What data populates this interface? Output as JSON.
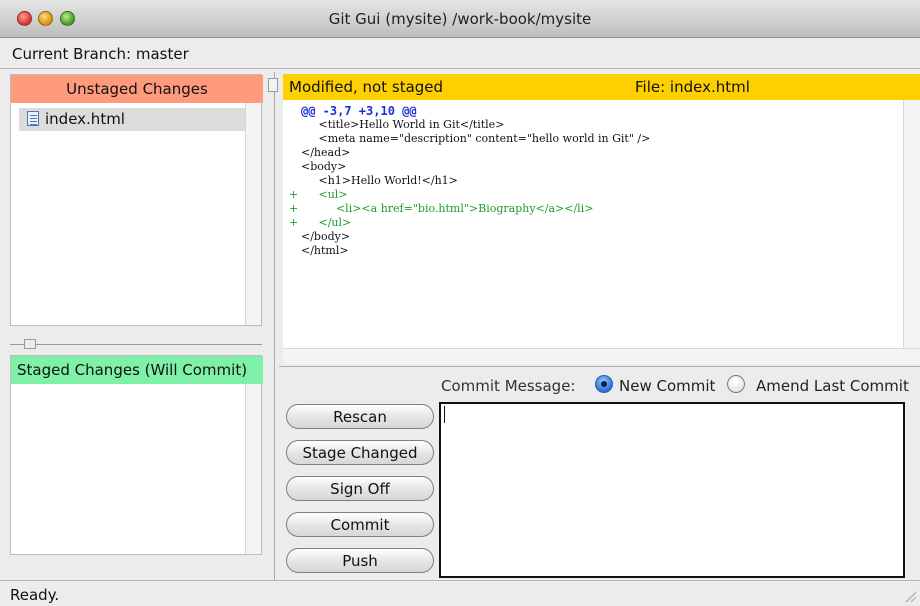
{
  "window": {
    "title": "Git Gui (mysite) /work-book/mysite",
    "colors": {
      "close": "#d63b2c",
      "minimize": "#d9930c",
      "zoom": "#4a9d26"
    }
  },
  "branch": {
    "label": "Current Branch: master"
  },
  "unstaged": {
    "header": "Unstaged Changes",
    "header_color": "#ff9a7c",
    "files": [
      {
        "name": "index.html",
        "icon": "document-icon"
      }
    ]
  },
  "staged": {
    "header": "Staged Changes (Will Commit)",
    "header_color": "#7ff0a8"
  },
  "diff": {
    "status": "Modified, not staged",
    "file": "File: index.html",
    "header_color": "#ffd000",
    "lines": [
      {
        "type": "hunk",
        "mark": "",
        "text": "@@ -3,7 +3,10 @@"
      },
      {
        "type": "context",
        "mark": "",
        "text": "     <title>Hello World in Git</title>"
      },
      {
        "type": "context",
        "mark": "",
        "text": "     <meta name=\"description\" content=\"hello world in Git\" />"
      },
      {
        "type": "context",
        "mark": "",
        "text": "</head>"
      },
      {
        "type": "context",
        "mark": "",
        "text": "<body>"
      },
      {
        "type": "context",
        "mark": "",
        "text": "     <h1>Hello World!</h1>"
      },
      {
        "type": "add",
        "mark": "+",
        "text": "     <ul>"
      },
      {
        "type": "add",
        "mark": "+",
        "text": "          <li><a href=\"bio.html\">Biography</a></li>"
      },
      {
        "type": "add",
        "mark": "+",
        "text": "     </ul>"
      },
      {
        "type": "context",
        "mark": "",
        "text": "</body>"
      },
      {
        "type": "context",
        "mark": "",
        "text": "</html>"
      }
    ]
  },
  "commit": {
    "label": "Commit Message:",
    "new_commit": "New Commit",
    "amend": "Amend Last Commit",
    "selected": "New Commit",
    "message": ""
  },
  "buttons": {
    "rescan": "Rescan",
    "stage_changed": "Stage Changed",
    "sign_off": "Sign Off",
    "commit": "Commit",
    "push": "Push"
  },
  "status": {
    "text": "Ready."
  }
}
